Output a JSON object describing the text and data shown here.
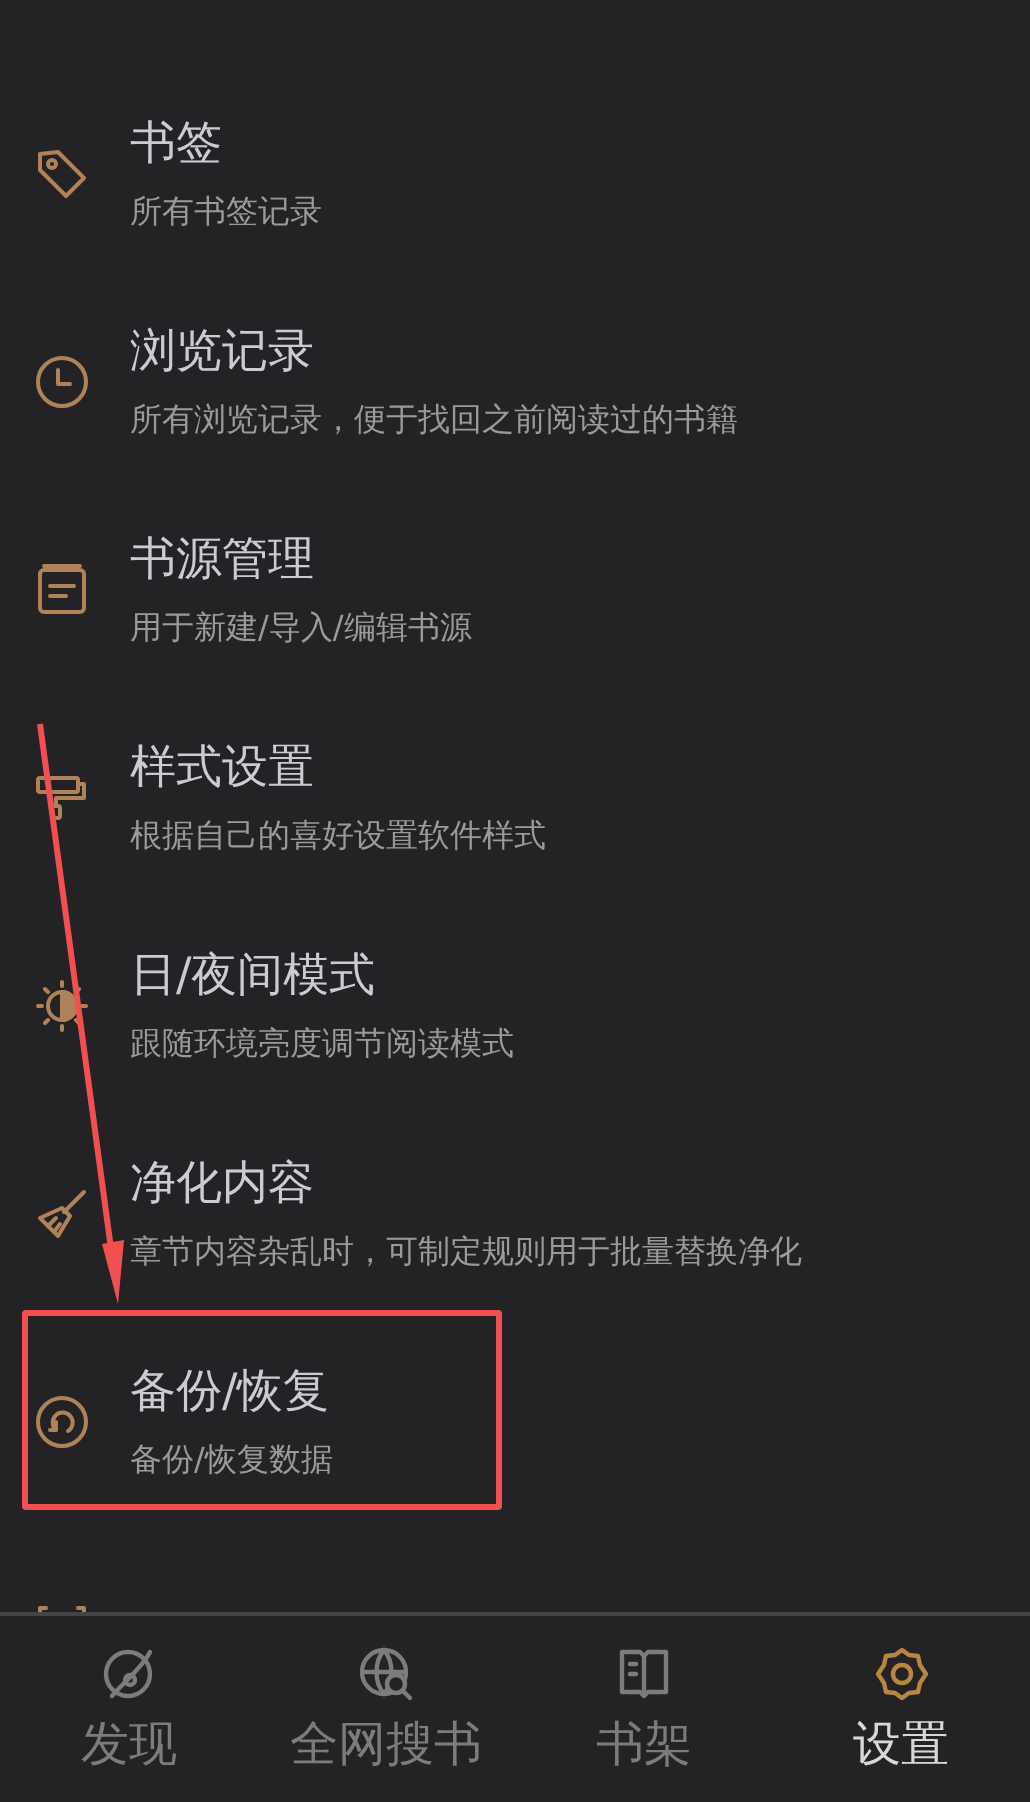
{
  "settings_list": [
    {
      "kind": "tag",
      "title": "书签",
      "subtitle": "所有书签记录",
      "highlighted": false
    },
    {
      "kind": "clock",
      "title": "浏览记录",
      "subtitle": "所有浏览记录，便于找回之前阅读过的书籍",
      "highlighted": false
    },
    {
      "kind": "list",
      "title": "书源管理",
      "subtitle": "用于新建/导入/编辑书源",
      "highlighted": false
    },
    {
      "kind": "roller",
      "title": "样式设置",
      "subtitle": "根据自己的喜好设置软件样式",
      "highlighted": false
    },
    {
      "kind": "sun",
      "title": "日/夜间模式",
      "subtitle": "跟随环境亮度调节阅读模式",
      "highlighted": false
    },
    {
      "kind": "broom",
      "title": "净化内容",
      "subtitle": "章节内容杂乱时，可制定规则用于批量替换净化",
      "highlighted": false
    },
    {
      "kind": "restore",
      "title": "备份/恢复",
      "subtitle": "备份/恢复数据",
      "highlighted": true
    },
    {
      "kind": "upload"
    }
  ],
  "bottom_nav": [
    {
      "kind": "discover",
      "label": "发现",
      "selected": false
    },
    {
      "kind": "globe",
      "label": "全网搜书",
      "selected": false
    },
    {
      "kind": "book",
      "label": "书架",
      "selected": false
    },
    {
      "kind": "gear",
      "label": "设置",
      "selected": true
    }
  ]
}
